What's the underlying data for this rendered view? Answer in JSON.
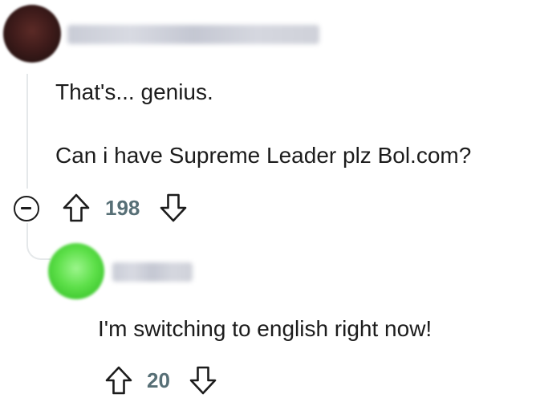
{
  "comments": [
    {
      "avatar_color": "#3e1b1a",
      "username": "",
      "text_lines": [
        "That's... genius.",
        "Can i have Supreme Leader plz Bol.com?"
      ],
      "score": "198",
      "icons": {
        "collapse": "collapse-minus-icon",
        "upvote": "upvote-arrow-icon",
        "downvote": "downvote-arrow-icon"
      }
    },
    {
      "avatar_color": "#5ee04a",
      "username": "",
      "text_lines": [
        "I'm switching to english right now!"
      ],
      "score": "20",
      "icons": {
        "upvote": "upvote-arrow-icon",
        "downvote": "downvote-arrow-icon"
      }
    }
  ],
  "colors": {
    "text": "#1c1c1c",
    "score": "#576f76",
    "thread_line": "#e5e8ea"
  }
}
